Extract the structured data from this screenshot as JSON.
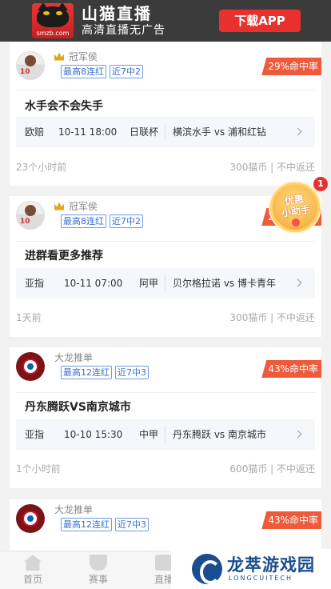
{
  "banner": {
    "logo_text": "smzb.com",
    "title": "山猫直播",
    "subtitle": "高清直播无广告",
    "download_label": "下载APP",
    "accent": "#e8312f"
  },
  "cards": [
    {
      "avatar": "player-photo",
      "name": "冠军侯",
      "tags": [
        "最高8连红",
        "近7中2"
      ],
      "rate": "29%命中率",
      "title": "水手会不会失手",
      "match": {
        "type": "欧赔",
        "time": "10-11 18:00",
        "league": "日联杯",
        "teams": "横滨水手 vs 浦和红钻"
      },
      "posted": "23个小时前",
      "price": "300猫币 | 不中返还"
    },
    {
      "avatar": "player-photo",
      "name": "冠军侯",
      "tags": [
        "最高8连红",
        "近7中2"
      ],
      "rate": "29%命中率",
      "title": "进群看更多推荐",
      "match": {
        "type": "亚指",
        "time": "10-11 07:00",
        "league": "阿甲",
        "teams": "贝尔格拉诺 vs 博卡青年"
      },
      "posted": "1天前",
      "price": "300猫币 | 不中返还"
    },
    {
      "avatar": "club-crest",
      "name": "大龙推单",
      "tags": [
        "最高12连红",
        "近7中3"
      ],
      "rate": "43%命中率",
      "title": "丹东腾跃VS南京城市",
      "match": {
        "type": "亚指",
        "time": "10-10 15:30",
        "league": "中甲",
        "teams": "丹东腾跃 vs 南京城市"
      },
      "posted": "1个小时前",
      "price": "600猫币 | 不中返还"
    },
    {
      "avatar": "club-crest",
      "name": "大龙推单",
      "tags": [
        "最高12连红",
        "近7中3"
      ],
      "rate": "43%命中率"
    }
  ],
  "promo": {
    "text_line1": "优惠",
    "text_line2": "小助手",
    "badge_count": "1"
  },
  "bottom_nav": [
    {
      "label": "首页",
      "icon": "home-icon"
    },
    {
      "label": "赛事",
      "icon": "trophy-icon"
    },
    {
      "label": "直播",
      "icon": "live-icon"
    }
  ],
  "watermark": {
    "title": "龙萃游戏园",
    "subtitle": "LONGCUITECH"
  }
}
